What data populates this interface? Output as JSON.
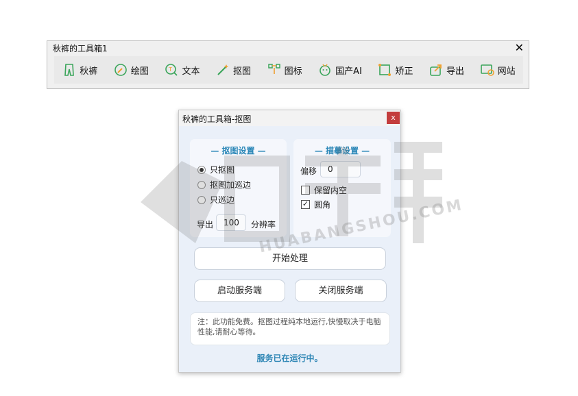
{
  "toolbar": {
    "title": "秋裤的工具箱1",
    "close_glyph": "✕",
    "tools": [
      {
        "label": "秋裤",
        "icon": "pants-icon"
      },
      {
        "label": "绘图",
        "icon": "draw-icon"
      },
      {
        "label": "文本",
        "icon": "text-icon"
      },
      {
        "label": "抠图",
        "icon": "magic-wand-icon"
      },
      {
        "label": "图标",
        "icon": "node-icon"
      },
      {
        "label": "国产AI",
        "icon": "robot-icon"
      },
      {
        "label": "矫正",
        "icon": "crop-icon"
      },
      {
        "label": "导出",
        "icon": "export-icon"
      },
      {
        "label": "网站",
        "icon": "globe-icon"
      }
    ]
  },
  "dialog": {
    "title": "秋裤的工具箱-抠图",
    "close_glyph": "x",
    "left_panel": {
      "heading": "— 抠图设置 —",
      "options": [
        "只抠图",
        "抠图加巡边",
        "只巡边"
      ],
      "selected": "只抠图",
      "export_label": "导出",
      "export_value": "100",
      "resolution_label": "分辨率"
    },
    "right_panel": {
      "heading": "— 描摹设置 —",
      "offset_label": "偏移",
      "offset_value": "0",
      "keep_inner": "保留内空",
      "keep_inner_checked": false,
      "round_corner": "圆角",
      "round_corner_checked": true,
      "check_glyph": "✓"
    },
    "start_button": "开始处理",
    "start_server_button": "启动服务端",
    "stop_server_button": "关闭服务端",
    "note": "注：此功能免费。抠图过程纯本地运行,快慢取决于电脑性能,请耐心等待。",
    "status": "服务已在运行中。",
    "accent_color": "#2c88b8"
  },
  "watermark": {
    "text": "HUABANGSHOU.COM"
  }
}
